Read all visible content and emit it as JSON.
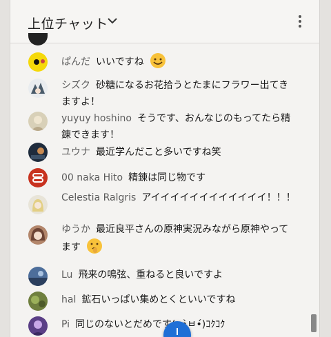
{
  "header": {
    "title": "上位チャット",
    "chevron_icon": "chevron-down-icon",
    "menu_icon": "kebab-menu-icon"
  },
  "messages": [
    {
      "author": "ぱんだ",
      "text": "いいですね",
      "emoji": "smile-emoji",
      "avatar_icon": "panda-avatar"
    },
    {
      "author": "シズク",
      "text": "砂糖になるお花拾うとたまにフラワー出てきますよ！",
      "avatar_icon": "anime-avatar"
    },
    {
      "author": "yuyuy hoshino",
      "text": "そうです、おんなじのもってたら精錬できます！",
      "avatar_icon": "character-avatar"
    },
    {
      "author": "ユウナ",
      "text": "最近学んだこと多いですね笑",
      "avatar_icon": "dark-avatar"
    },
    {
      "author": "00 naka Hito",
      "text": "精錬は同じ物です",
      "avatar_icon": "logo-avatar"
    },
    {
      "author": "Celestia Ralgris",
      "text": "アイイイイイイイイイイイイ！！！",
      "avatar_icon": "blonde-avatar"
    },
    {
      "author": "ゆうか",
      "text": "最近良平さんの原神実況みながら原神やってます",
      "emoji": "hush-emoji",
      "avatar_icon": "girl-avatar"
    },
    {
      "author": "Lu",
      "text": "飛来の鳴弦、重ねると良いですよ",
      "avatar_icon": "scenery-avatar"
    },
    {
      "author": "hal",
      "text": "鉱石いっぱい集めとくといいですね",
      "avatar_icon": "green-avatar"
    },
    {
      "author": "Pi",
      "text": "同じのないとだめです(๑•̀ㅂ•́)ｺｸｺｸ",
      "avatar_icon": "purple-avatar"
    }
  ],
  "colors": {
    "accent": "#1f6fd6",
    "author": "#5c5c5c"
  }
}
